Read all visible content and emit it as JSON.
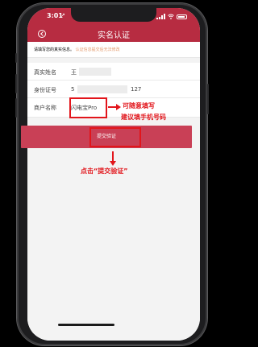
{
  "status_bar": {
    "time": "3:01",
    "location_arrow": "↗"
  },
  "nav": {
    "title": "实名认证",
    "back_icon": "back-arrow-icon"
  },
  "notice": {
    "text": "请填写您的真实信息。",
    "warning": "认证信息提交后无法修改"
  },
  "form": {
    "real_name": {
      "label": "真实姓名",
      "value": "王"
    },
    "id_number": {
      "label": "身份证号",
      "prefix": "5",
      "suffix": "127"
    },
    "merchant_name": {
      "label": "商户名称",
      "value": "闪电宝Pro"
    }
  },
  "submit_button": {
    "label": "提交验证"
  },
  "annotations": {
    "merchant_note_line1": "可随意填写",
    "merchant_note_line2": "建议填手机号码",
    "submit_note": "点击“提交验证”"
  },
  "colors": {
    "brand": "#b72c41",
    "submit": "#c94056",
    "annotation": "#e2151b",
    "warning_text": "#e39a6c"
  }
}
